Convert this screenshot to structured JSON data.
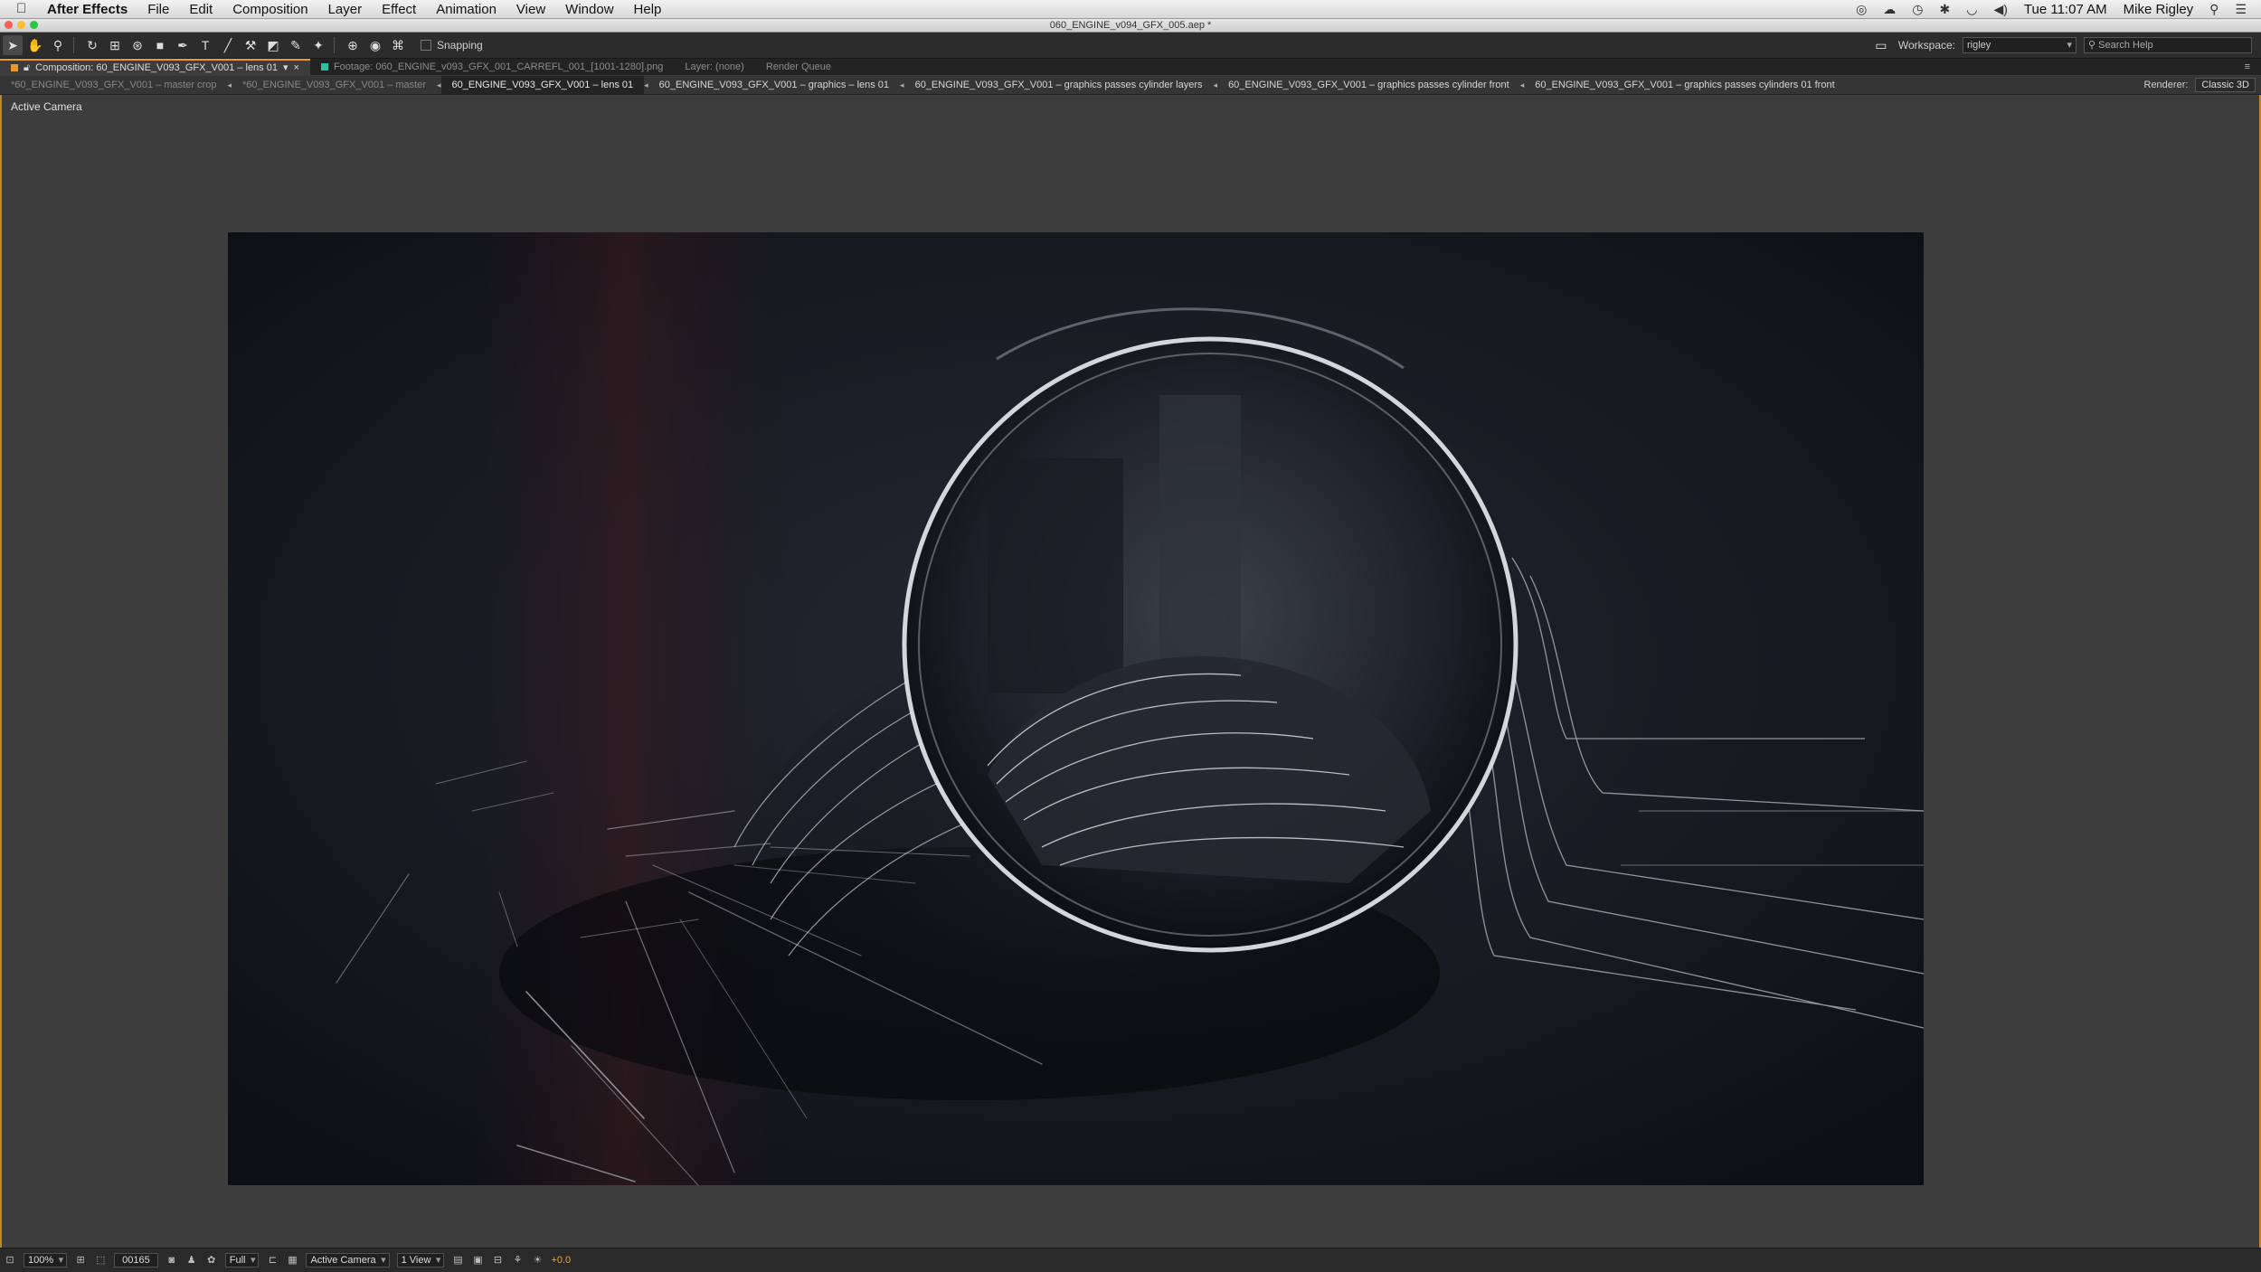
{
  "menubar": {
    "app_name": "After Effects",
    "items": [
      "File",
      "Edit",
      "Composition",
      "Layer",
      "Effect",
      "Animation",
      "View",
      "Window",
      "Help"
    ],
    "clock": "Tue 11:07 AM",
    "user": "Mike Rigley",
    "status_icons": [
      "creative-cloud-icon",
      "cloud-icon",
      "time-machine-icon",
      "bluetooth-icon",
      "wifi-icon",
      "volume-icon"
    ]
  },
  "window": {
    "title": "060_ENGINE_v094_GFX_005.aep *"
  },
  "toolbar": {
    "snapping_label": "Snapping",
    "workspace_label": "Workspace:",
    "workspace_value": "rigley",
    "search_placeholder": "Search Help"
  },
  "panel_tabs": {
    "composition": "Composition: 60_ENGINE_V093_GFX_V001 – lens 01",
    "footage": "Footage: 060_ENGINE_v093_GFX_001_CARREFL_001_[1001-1280].png",
    "layer": "Layer: (none)",
    "render_queue": "Render Queue"
  },
  "comp_tabs": [
    {
      "label": "*60_ENGINE_V093_GFX_V001 – master crop",
      "state": "dim"
    },
    {
      "label": "*60_ENGINE_V093_GFX_V001 – master",
      "state": "dim"
    },
    {
      "label": "60_ENGINE_V093_GFX_V001 – lens 01",
      "state": "active"
    },
    {
      "label": "60_ENGINE_V093_GFX_V001 – graphics – lens 01",
      "state": "normal"
    },
    {
      "label": "60_ENGINE_V093_GFX_V001 – graphics passes cylinder layers",
      "state": "normal"
    },
    {
      "label": "60_ENGINE_V093_GFX_V001 – graphics passes cylinder front",
      "state": "normal"
    },
    {
      "label": "60_ENGINE_V093_GFX_V001 – graphics passes cylinders 01 front",
      "state": "normal"
    }
  ],
  "renderer": {
    "label": "Renderer:",
    "value": "Classic 3D"
  },
  "viewer": {
    "camera_label": "Active Camera"
  },
  "bottom_bar": {
    "zoom": "100%",
    "frame": "00165",
    "resolution": "Full",
    "camera": "Active Camera",
    "views": "1 View",
    "exposure": "+0.0"
  },
  "colors": {
    "accent": "#e89b25",
    "background": "#3b3b3b",
    "frame_bg": "#1a1d24"
  }
}
